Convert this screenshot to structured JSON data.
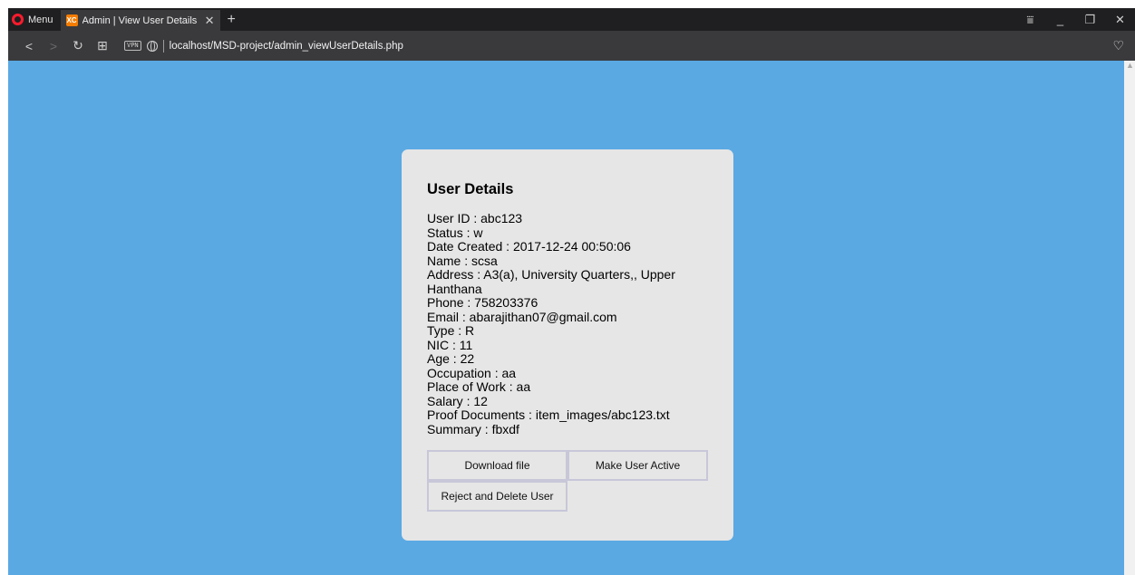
{
  "browser": {
    "menu_label": "Menu",
    "tab_title": "Admin | View User Details",
    "tab_close": "✕",
    "new_tab": "+",
    "url": "localhost/MSD-project/admin_viewUserDetails.php",
    "vpn_label": "VPN",
    "favicon_text": "XC"
  },
  "card": {
    "title": "User Details",
    "details": [
      "User ID : abc123",
      "Status : w",
      "Date Created : 2017-12-24 00:50:06",
      "Name : scsa",
      "Address : A3(a), University Quarters,, Upper Hanthana",
      "Phone : 758203376",
      "Email : abarajithan07@gmail.com",
      "Type : R",
      "NIC : 11",
      "Age : 22",
      "Occupation : aa",
      "Place of Work : aa",
      "Salary : 12",
      "Proof Documents : item_images/abc123.txt",
      "Summary : fbxdf"
    ],
    "buttons": {
      "download": "Download file",
      "activate": "Make User Active",
      "reject": "Reject and Delete User"
    }
  },
  "colors": {
    "page_background": "#5aa9e3",
    "card_background": "#e6e6e6",
    "button_border": "#c7c7d9"
  }
}
